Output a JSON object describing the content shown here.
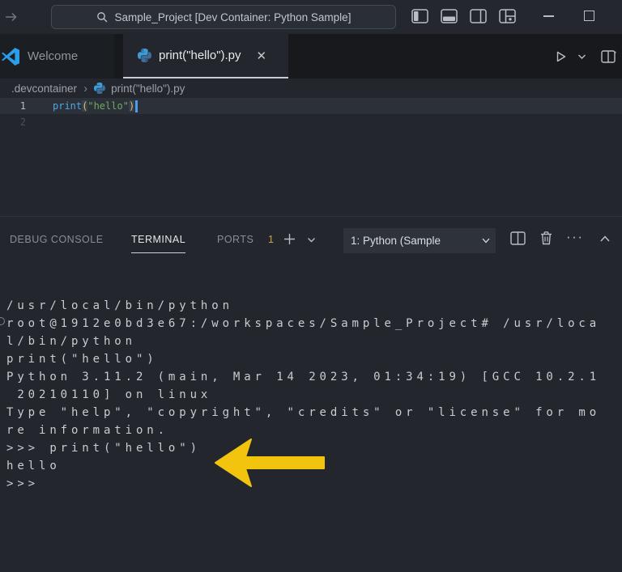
{
  "titlebar": {
    "command_center_text": "Sample_Project [Dev Container: Python Sample]"
  },
  "editor_tabs": {
    "welcome": "Welcome",
    "active_file": "print(\"hello\").py"
  },
  "breadcrumb": {
    "folder": ".devcontainer",
    "separator": "›",
    "file": "print(\"hello\").py"
  },
  "editor": {
    "line1": {
      "number": "1",
      "func": "print",
      "paren_open": "(",
      "string_literal": "\"hello\"",
      "paren_close": ")"
    },
    "line2": {
      "number": "2"
    }
  },
  "panel": {
    "tab_debug": "DEBUG CONSOLE",
    "tab_terminal": "TERMINAL",
    "tab_ports": "PORTS",
    "ports_count": "1",
    "terminal_selector": "1: Python (Sample"
  },
  "terminal": {
    "lines": [
      "/usr/local/bin/python",
      "root@1912e0bd3e67:/workspaces/Sample_Project# /usr/loca",
      "l/bin/python",
      "print(\"hello\")",
      "Python 3.11.2 (main, Mar 14 2023, 01:34:19) [GCC 10.2.1",
      " 20210110] on linux",
      "Type \"help\", \"copyright\", \"credits\" or \"license\" for mo",
      "re information.",
      ">>> print(\"hello\")",
      "hello",
      ">>>"
    ]
  },
  "icons": {
    "close": "✕",
    "more_horizontal": "···"
  },
  "colors": {
    "accent_blue": "#2C9DE8",
    "annotation_arrow": "#F2C40E",
    "string_green": "#74A95C",
    "function_blue": "#4FA6E0",
    "ports_badge": "#C7A34D"
  }
}
